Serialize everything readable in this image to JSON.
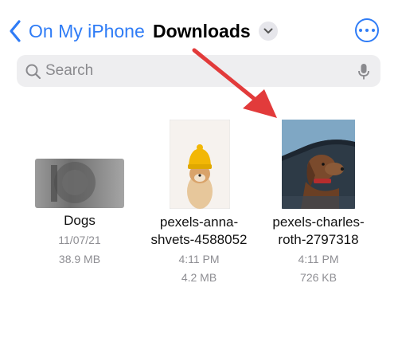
{
  "nav": {
    "back_label": "On My iPhone",
    "title": "Downloads",
    "back_icon": "chevron-left-icon",
    "title_menu_icon": "chevron-down-icon",
    "more_icon": "ellipsis-circle-icon"
  },
  "search": {
    "placeholder": "Search",
    "search_icon": "magnifying-glass-icon",
    "mic_icon": "microphone-icon"
  },
  "files": [
    {
      "name_line1": "Dogs",
      "name_line2": "",
      "date": "11/07/21",
      "size": "38.9 MB",
      "thumbnail": "folder-photo"
    },
    {
      "name_line1": "pexels-anna-",
      "name_line2": "shvets-4588052",
      "time": "4:11 PM",
      "size": "4.2 MB",
      "thumbnail": "shiba-with-yellow-hat"
    },
    {
      "name_line1": "pexels-charles-",
      "name_line2": "roth-2797318",
      "time": "4:11 PM",
      "size": "726 KB",
      "thumbnail": "dog-in-car-window"
    }
  ],
  "colors": {
    "accent": "#2f7cf6",
    "annotation_arrow": "#e23b3b",
    "secondary_text": "#8e8e93",
    "search_bg": "#eeeef0"
  }
}
